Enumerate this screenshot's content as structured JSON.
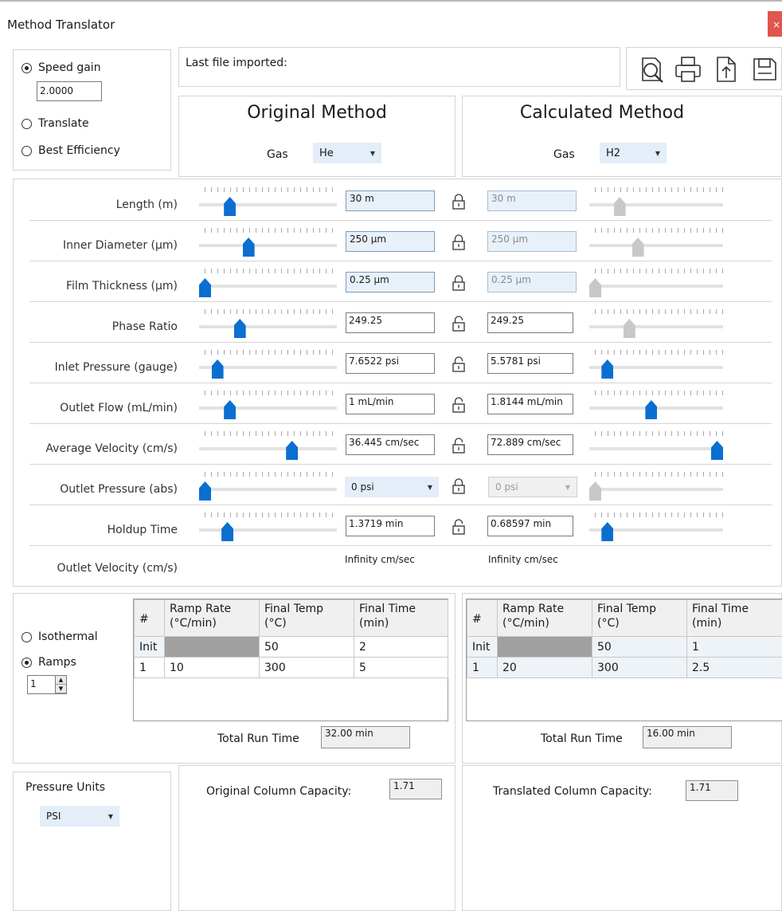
{
  "window": {
    "title": "Method Translator",
    "close_glyph": "×"
  },
  "mode": {
    "options": [
      {
        "label": "Speed gain",
        "selected": true
      },
      {
        "label": "Translate",
        "selected": false
      },
      {
        "label": "Best Efficiency",
        "selected": false
      }
    ],
    "speed_gain_value": "2.0000"
  },
  "file_info": {
    "label": "Last file imported:"
  },
  "toolbar": {
    "icons": [
      "preview-icon",
      "print-icon",
      "import-icon",
      "save-icon"
    ]
  },
  "original": {
    "heading": "Original Method",
    "gas_label": "Gas",
    "gas_value": "He"
  },
  "calculated": {
    "heading": "Calculated Method",
    "gas_label": "Gas",
    "gas_value": "H2"
  },
  "parameters": [
    {
      "label": "Length (m)",
      "orig_value": "30 m",
      "calc_value": "30 m",
      "locked": true,
      "orig_level": 0.2,
      "calc_level": 0.2
    },
    {
      "label": "Inner Diameter (µm)",
      "orig_value": "250 µm",
      "calc_value": "250 µm",
      "locked": true,
      "orig_level": 0.35,
      "calc_level": 0.35
    },
    {
      "label": "Film Thickness (µm)",
      "orig_value": "0.25 µm",
      "calc_value": "0.25 µm",
      "locked": true,
      "orig_level": 0.0,
      "calc_level": 0.0
    },
    {
      "label": "Phase Ratio",
      "orig_value": "249.25",
      "calc_value": "249.25",
      "locked": false,
      "orig_level": 0.28,
      "calc_level": 0.28
    },
    {
      "label": "Inlet Pressure (gauge)",
      "orig_value": "7.6522 psi",
      "calc_value": "5.5781 psi",
      "locked": false,
      "orig_level": 0.1,
      "calc_level": 0.1
    },
    {
      "label": "Outlet Flow (mL/min)",
      "orig_value": "1 mL/min",
      "calc_value": "1.8144 mL/min",
      "locked": false,
      "orig_level": 0.2,
      "calc_level": 0.46
    },
    {
      "label": "Average Velocity (cm/s)",
      "orig_value": "36.445 cm/sec",
      "calc_value": "72.889 cm/sec",
      "locked": false,
      "orig_level": 0.7,
      "calc_level": 1.0
    },
    {
      "label": "Outlet Pressure (abs)",
      "orig_value": "0 psi",
      "calc_value": "0 psi",
      "locked": true,
      "orig_level": 0.0,
      "calc_level": 0.0
    },
    {
      "label": "Holdup Time",
      "orig_value": "1.3719 min",
      "calc_value": "0.68597 min",
      "locked": false,
      "orig_level": 0.18,
      "calc_level": 0.1
    }
  ],
  "outlet_velocity": {
    "label": "Outlet Velocity (cm/s)",
    "orig_value": "Infinity cm/sec",
    "calc_value": "Infinity cm/sec"
  },
  "temperature": {
    "options": [
      {
        "label": "Isothermal",
        "selected": false
      },
      {
        "label": "Ramps",
        "selected": true
      }
    ],
    "ramp_count": "1",
    "columns": [
      "#",
      "Ramp Rate (°C/min)",
      "Final Temp (°C)",
      "Final Time (min)"
    ],
    "original_rows": [
      [
        "Init",
        "",
        "50",
        "2"
      ],
      [
        "1",
        "10",
        "300",
        "5"
      ]
    ],
    "calculated_rows": [
      [
        "Init",
        "",
        "50",
        "1"
      ],
      [
        "1",
        "20",
        "300",
        "2.5"
      ]
    ],
    "total_run_time_label": "Total Run Time",
    "original_total": "32.00 min",
    "calculated_total": "16.00 min"
  },
  "pressure_units": {
    "label": "Pressure Units",
    "value": "PSI"
  },
  "capacity": {
    "original_label": "Original Column Capacity:",
    "original_value": "1.71",
    "translated_label": "Translated Column Capacity:",
    "translated_value": "1.71"
  }
}
